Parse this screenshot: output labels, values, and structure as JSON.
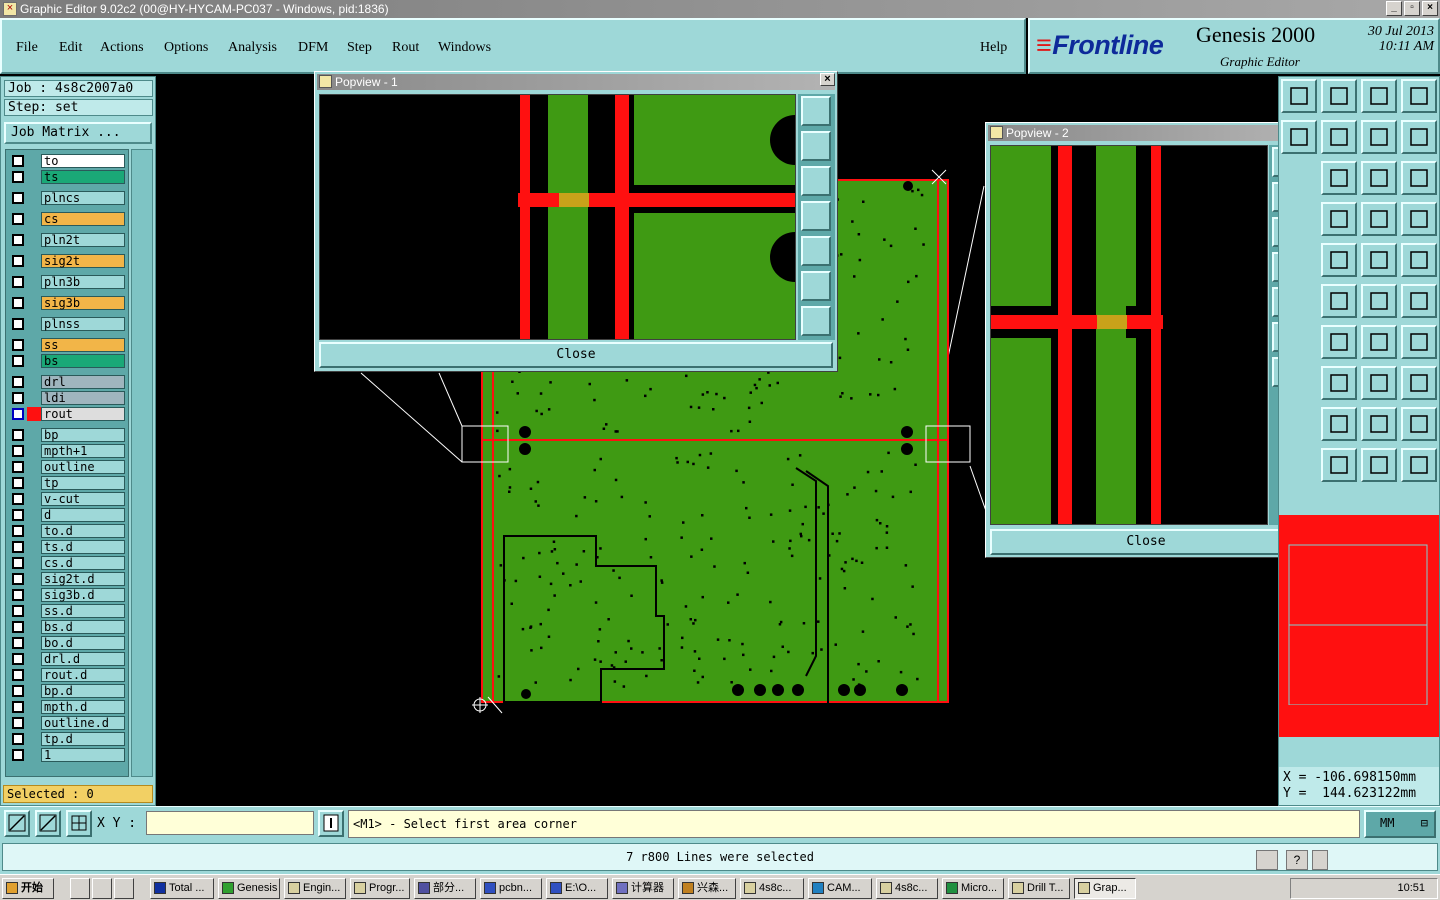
{
  "window": {
    "title": "Graphic Editor 9.02c2 (00@HY-HYCAM-PC037 - Windows, pid:1836)"
  },
  "menu": [
    "File",
    "Edit",
    "Actions",
    "Options",
    "Analysis",
    "DFM",
    "Step",
    "Rout",
    "Windows"
  ],
  "help": "Help",
  "brand": {
    "logo": "Frontline",
    "product": "Genesis 2000",
    "subtitle": "Graphic Editor",
    "date": "30 Jul 2013",
    "time": "10:11 AM"
  },
  "job": {
    "job_label": "Job : 4s8c2007a0",
    "step_label": "Step: set",
    "matrix_button": "Job Matrix ..."
  },
  "layers": [
    {
      "name": "to",
      "color": "#ffffff"
    },
    {
      "name": "ts",
      "color": "#1aa877"
    },
    {
      "name": "plncs",
      "color": "#9ed8d8"
    },
    {
      "name": "cs",
      "color": "#f2b548"
    },
    {
      "name": "pln2t",
      "color": "#9ed8d8"
    },
    {
      "name": "sig2t",
      "color": "#f2b548"
    },
    {
      "name": "pln3b",
      "color": "#9ed8d8"
    },
    {
      "name": "sig3b",
      "color": "#f2b548"
    },
    {
      "name": "plnss",
      "color": "#9ed8d8"
    },
    {
      "name": "ss",
      "color": "#f2b548"
    },
    {
      "name": "bs",
      "color": "#1aa877"
    },
    {
      "name": "drl",
      "color": "#9fb5be"
    },
    {
      "name": "ldi",
      "color": "#9fb5be"
    },
    {
      "name": "rout",
      "color": "#dddddd"
    },
    {
      "name": "bp",
      "color": "#9ed8d8"
    },
    {
      "name": "mpth+1",
      "color": "#9ed8d8"
    },
    {
      "name": "outline",
      "color": "#9ed8d8"
    },
    {
      "name": "tp",
      "color": "#9ed8d8"
    },
    {
      "name": "v-cut",
      "color": "#9ed8d8"
    },
    {
      "name": "d",
      "color": "#9ed8d8"
    },
    {
      "name": "to.d",
      "color": "#9ed8d8"
    },
    {
      "name": "ts.d",
      "color": "#9ed8d8"
    },
    {
      "name": "cs.d",
      "color": "#9ed8d8"
    },
    {
      "name": "sig2t.d",
      "color": "#9ed8d8"
    },
    {
      "name": "sig3b.d",
      "color": "#9ed8d8"
    },
    {
      "name": "ss.d",
      "color": "#9ed8d8"
    },
    {
      "name": "bs.d",
      "color": "#9ed8d8"
    },
    {
      "name": "bo.d",
      "color": "#9ed8d8"
    },
    {
      "name": "drl.d",
      "color": "#9ed8d8"
    },
    {
      "name": "rout.d",
      "color": "#9ed8d8"
    },
    {
      "name": "bp.d",
      "color": "#9ed8d8"
    },
    {
      "name": "mpth.d",
      "color": "#9ed8d8"
    },
    {
      "name": "outline.d",
      "color": "#9ed8d8"
    },
    {
      "name": "tp.d",
      "color": "#9ed8d8"
    },
    {
      "name": "1",
      "color": "#9ed8d8"
    }
  ],
  "selected": "Selected : 0",
  "popview1": {
    "title": "Popview - 1",
    "close_label": "Close"
  },
  "popview2": {
    "title": "Popview - 2",
    "close_label": "Close"
  },
  "coords": {
    "x": "X = -106.698150mm",
    "y": "Y =  144.623122mm"
  },
  "cmd": {
    "xy_label": "X Y :",
    "xy_value": "",
    "prompt": "<M1> - Select first area corner",
    "units": "MM"
  },
  "status": "7 r800 Lines were selected",
  "taskbar": {
    "start": "开始",
    "tasks": [
      "Total ...",
      "Genesis",
      "Engin...",
      "Progr...",
      "部分...",
      "pcbn...",
      "E:\\O...",
      "计算器",
      "兴森...",
      "4s8c...",
      "CAM...",
      "4s8c...",
      "Micro...",
      "Drill T...",
      "Grap..."
    ],
    "clock": "10:51"
  },
  "colors": {
    "board": "#3f9a13",
    "route": "#ff1010",
    "panel": "#9ed8d8",
    "overlap": "#c8a21a"
  }
}
